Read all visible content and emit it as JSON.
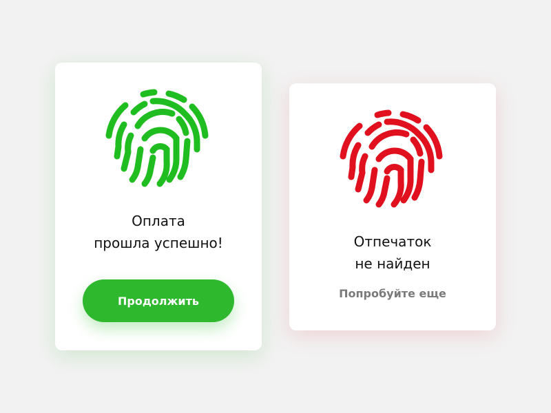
{
  "success_card": {
    "title_line1": "Оплата",
    "title_line2": "прошла успешно!",
    "button_label": "Продолжить",
    "accent_color": "#2db82d",
    "fingerprint_color": "#1fbd1f",
    "icon": "fingerprint-icon"
  },
  "error_card": {
    "title_line1": "Отпечаток",
    "title_line2": "не найден",
    "retry_label": "Попробуйте еще",
    "accent_color": "#e0101e",
    "icon": "fingerprint-icon"
  }
}
